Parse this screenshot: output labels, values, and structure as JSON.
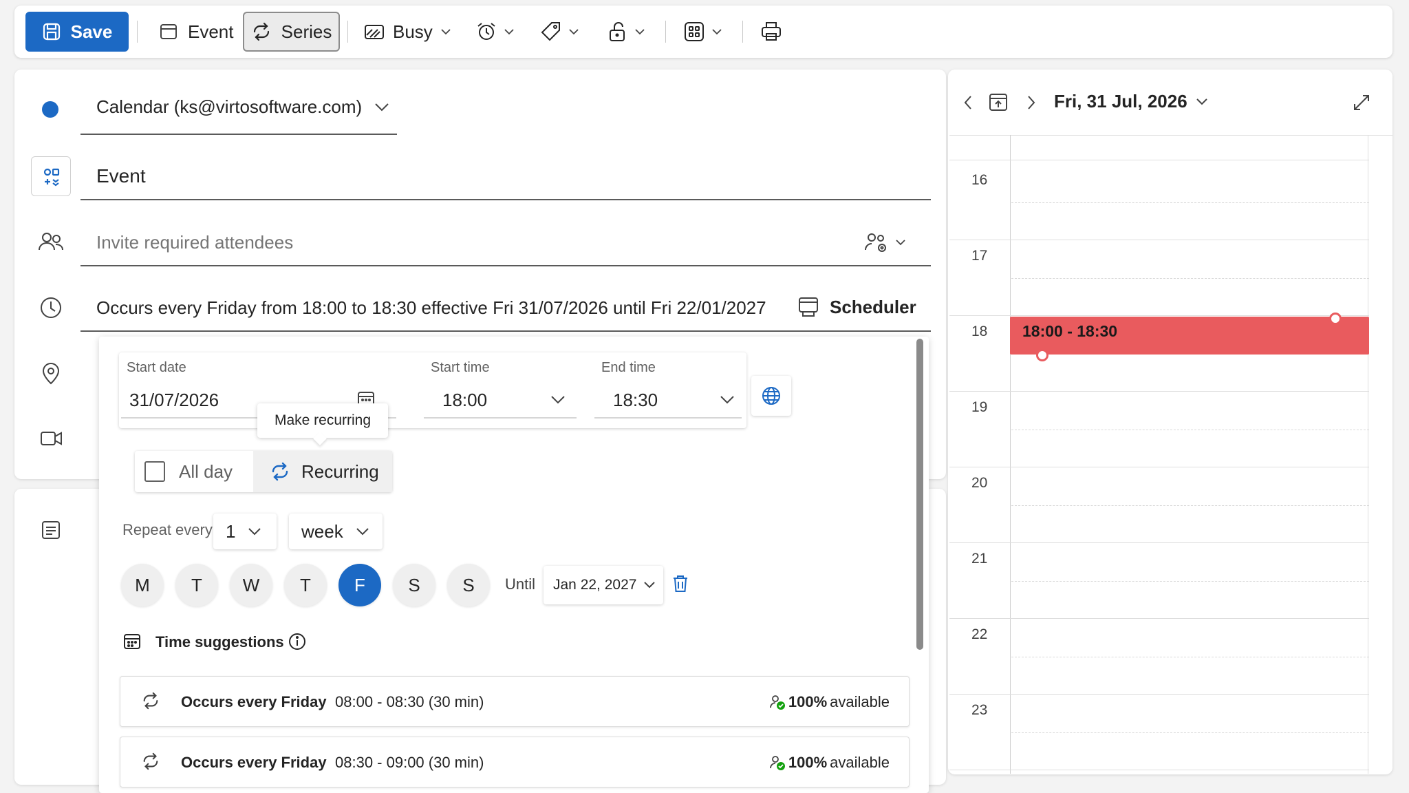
{
  "toolbar": {
    "save_label": "Save",
    "event_label": "Event",
    "series_label": "Series",
    "busy_label": "Busy"
  },
  "form": {
    "calendar_label": "Calendar (ks@virtosoftware.com)",
    "calendar_color": "#1c69c4",
    "title_value": "Event",
    "attendees_placeholder": "Invite required attendees",
    "occurrence_text": "Occurs every Friday from 18:00 to 18:30 effective Fri 31/07/2026 until Fri 22/01/2027",
    "scheduler_label": "Scheduler"
  },
  "time_panel": {
    "start_date_label": "Start date",
    "start_date_value": "31/07/2026",
    "start_time_label": "Start time",
    "start_time_value": "18:00",
    "end_time_label": "End time",
    "end_time_value": "18:30",
    "tooltip": "Make recurring",
    "all_day_label": "All day",
    "all_day_checked": false,
    "recurring_label": "Recurring",
    "repeat_every_label": "Repeat every",
    "repeat_interval": "1",
    "repeat_unit": "week",
    "days": [
      {
        "label": "M",
        "selected": false
      },
      {
        "label": "T",
        "selected": false
      },
      {
        "label": "W",
        "selected": false
      },
      {
        "label": "T",
        "selected": false
      },
      {
        "label": "F",
        "selected": true
      },
      {
        "label": "S",
        "selected": false
      },
      {
        "label": "S",
        "selected": false
      }
    ],
    "until_label": "Until",
    "until_value": "Jan 22, 2027",
    "time_suggestions_label": "Time suggestions",
    "suggestions": [
      {
        "title": "Occurs every Friday",
        "time": "08:00 - 08:30 (30 min)",
        "percent": "100%",
        "avail": "available"
      },
      {
        "title": "Occurs every Friday",
        "time": "08:30 - 09:00 (30 min)",
        "percent": "100%",
        "avail": "available"
      }
    ]
  },
  "calendar": {
    "date_label": "Fri, 31 Jul, 2026",
    "hours": [
      "16",
      "17",
      "18",
      "19",
      "20",
      "21",
      "22",
      "23"
    ],
    "event_label": "18:00 - 18:30",
    "event_color": "#e95b5e"
  }
}
